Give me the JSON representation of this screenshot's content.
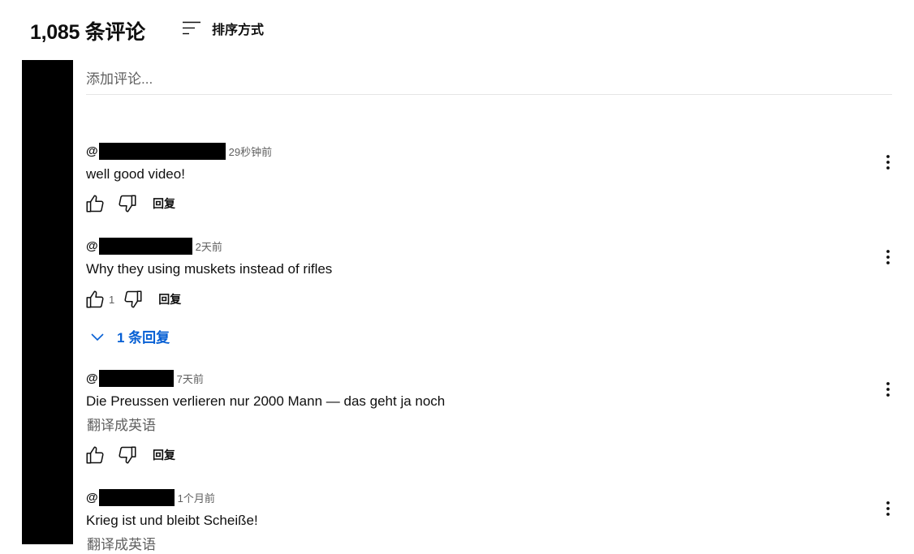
{
  "header": {
    "count_label": "1,085 条评论",
    "sort_label": "排序方式"
  },
  "add_comment": {
    "placeholder": "添加评论..."
  },
  "comments": [
    {
      "handle_prefix": "@",
      "time": "29秒钟前",
      "text": "well good video!",
      "translate": "",
      "likes": "",
      "reply_label": "回复",
      "replies_label": ""
    },
    {
      "handle_prefix": "@",
      "time": "2天前",
      "text": "Why they using muskets instead of rifles",
      "translate": "",
      "likes": "1",
      "reply_label": "回复",
      "replies_label": "1 条回复"
    },
    {
      "handle_prefix": "@",
      "time": "7天前",
      "text": "Die Preussen verlieren nur 2000 Mann — das geht ja noch",
      "translate": "翻译成英语",
      "likes": "",
      "reply_label": "回复",
      "replies_label": ""
    },
    {
      "handle_prefix": "@",
      "time": "1个月前",
      "text": "Krieg ist und bleibt Scheiße!",
      "translate": "翻译成英语",
      "likes": "",
      "reply_label": "回复",
      "replies_label": ""
    }
  ],
  "colors": {
    "link_blue": "#065fd4",
    "secondary_text": "#606060",
    "redaction": "#000000"
  },
  "icons": {
    "sort": "sort-lines-icon",
    "like": "thumbs-up-icon",
    "dislike": "thumbs-down-icon",
    "more": "more-vert-icon",
    "expand": "chevron-down-icon"
  }
}
